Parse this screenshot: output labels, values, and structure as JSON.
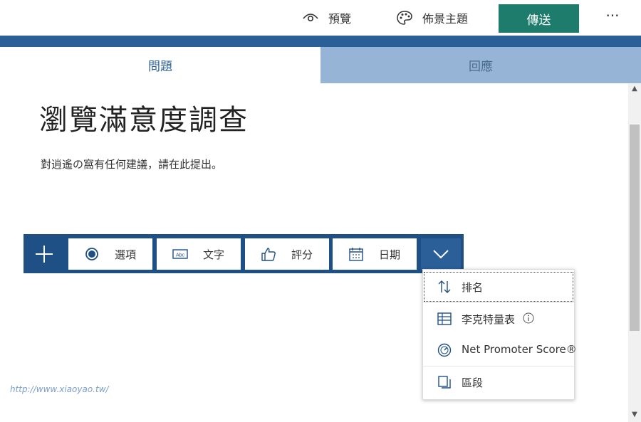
{
  "header": {
    "preview_label": "預覽",
    "theme_label": "佈景主題",
    "send_label": "傳送",
    "more_label": "···"
  },
  "tabs": [
    {
      "label": "問題",
      "active": true
    },
    {
      "label": "回應",
      "active": false
    }
  ],
  "form": {
    "title": "瀏覽滿意度調查",
    "description": "對逍遙の窩有任何建議，請在此提出。"
  },
  "toolbar": {
    "add_icon": "plus-icon",
    "buttons": [
      {
        "label": "選項",
        "icon": "radio-icon"
      },
      {
        "label": "文字",
        "icon": "text-abc-icon"
      },
      {
        "label": "評分",
        "icon": "thumbs-up-icon"
      },
      {
        "label": "日期",
        "icon": "calendar-icon"
      }
    ],
    "expand_icon": "chevron-down-icon"
  },
  "menu": {
    "items": [
      {
        "label": "排名",
        "icon": "sort-arrows-icon"
      },
      {
        "label": "李克特量表",
        "icon": "grid-icon"
      },
      {
        "label": "Net Promoter Score®",
        "icon": "gauge-icon"
      },
      {
        "label": "區段",
        "icon": "section-icon"
      }
    ]
  },
  "watermark": "http://www.xiaoyao.tw/",
  "colors": {
    "send_button": "#1d7c6b",
    "stripe": "#2a5f98",
    "toolbar": "#1e4f85",
    "inactive_tab": "#96b5d6"
  }
}
